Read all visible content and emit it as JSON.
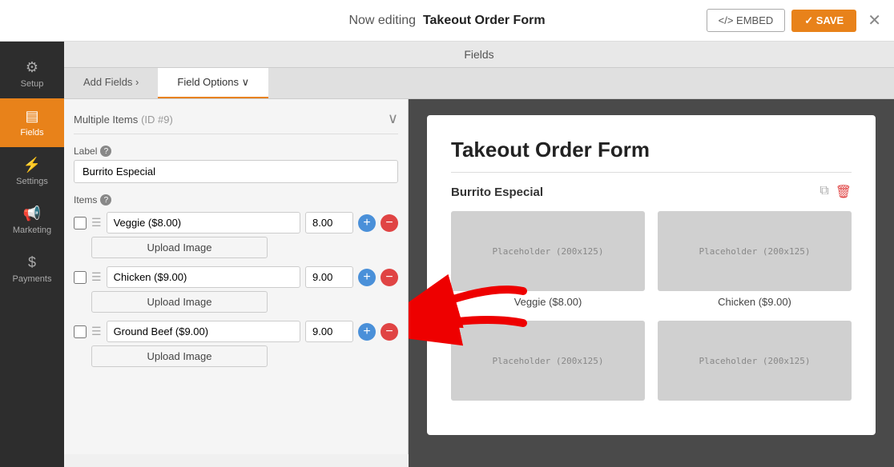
{
  "topbar": {
    "editing_prefix": "Now editing",
    "form_name": "Takeout Order Form",
    "embed_label": "</> EMBED",
    "save_label": "✓ SAVE",
    "close_icon": "✕"
  },
  "sidebar": {
    "items": [
      {
        "id": "setup",
        "label": "Setup",
        "icon": "⚙",
        "active": false
      },
      {
        "id": "fields",
        "label": "Fields",
        "icon": "▤",
        "active": true
      },
      {
        "id": "settings",
        "label": "Settings",
        "icon": "⚡",
        "active": false
      },
      {
        "id": "marketing",
        "label": "Marketing",
        "icon": "📢",
        "active": false
      },
      {
        "id": "payments",
        "label": "Payments",
        "icon": "$",
        "active": false
      }
    ]
  },
  "fields_tab": {
    "label": "Fields"
  },
  "sub_tabs": [
    {
      "id": "add-fields",
      "label": "Add Fields",
      "arrow": "›",
      "active": false
    },
    {
      "id": "field-options",
      "label": "Field Options",
      "arrow": "∨",
      "active": true
    }
  ],
  "field_options": {
    "multiple_items_label": "Multiple Items",
    "field_id": "(ID #9)",
    "label_section": "Label",
    "label_help": "?",
    "label_value": "Burrito Especial",
    "items_section": "Items",
    "items_help": "?",
    "items": [
      {
        "id": 1,
        "name": "Veggie ($8.00)",
        "price": "8.00",
        "upload_label": "Upload Image"
      },
      {
        "id": 2,
        "name": "Chicken ($9.00)",
        "price": "9.00",
        "upload_label": "Upload Image"
      },
      {
        "id": 3,
        "name": "Ground Beef ($9.00)",
        "price": "9.00",
        "upload_label": "Upload Image"
      }
    ]
  },
  "preview": {
    "form_title": "Takeout Order Form",
    "section_title": "Burrito Especial",
    "placeholder_text": "Placeholder (200x125)",
    "items": [
      {
        "name": "Veggie ($8.00)"
      },
      {
        "name": "Chicken ($9.00)"
      },
      {
        "name": ""
      },
      {
        "name": ""
      }
    ]
  }
}
